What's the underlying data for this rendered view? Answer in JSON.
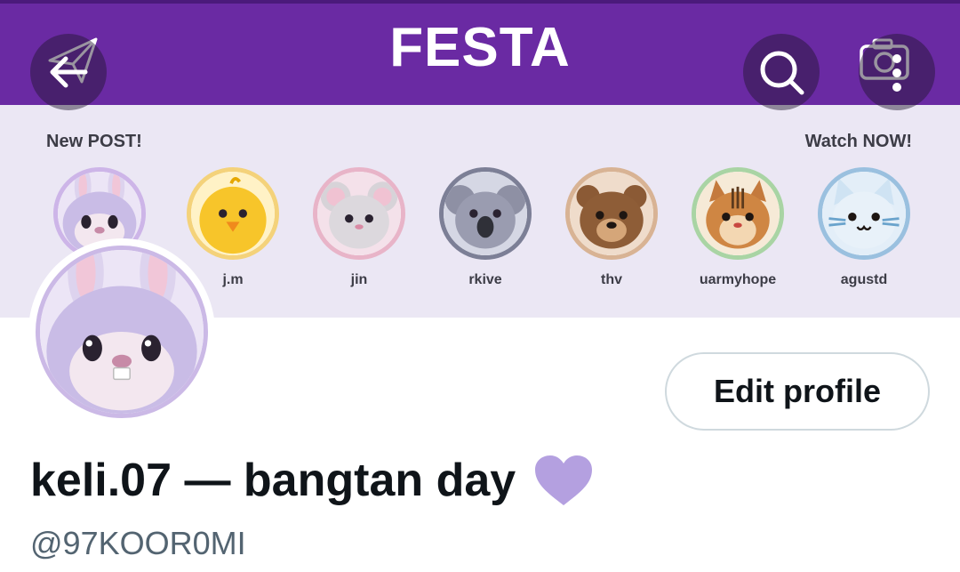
{
  "banner": {
    "title": "FESTA",
    "left_label": "New POST!",
    "right_label": "Watch NOW!",
    "stories": [
      {
        "name": "",
        "icon": "bunny-emoji"
      },
      {
        "name": "j.m",
        "icon": "chick-emoji"
      },
      {
        "name": "jin",
        "icon": "mouse-emoji"
      },
      {
        "name": "rkive",
        "icon": "koala-emoji"
      },
      {
        "name": "thv",
        "icon": "bear-emoji"
      },
      {
        "name": "uarmyhope",
        "icon": "squirrel-emoji"
      },
      {
        "name": "agustd",
        "icon": "cat-emoji"
      }
    ]
  },
  "toolbar": {
    "back_icon": "arrow-left-icon",
    "search_icon": "search-icon",
    "more_icon": "more-vertical-icon"
  },
  "profile": {
    "edit_label": "Edit profile",
    "display_name": "keli.07 — bangtan day",
    "handle": "@97KOOR0MI",
    "heart_color": "#b4a0e0"
  },
  "colors": {
    "festa_purple": "#6a2aa3",
    "banner_bg": "#ebe7f4"
  }
}
